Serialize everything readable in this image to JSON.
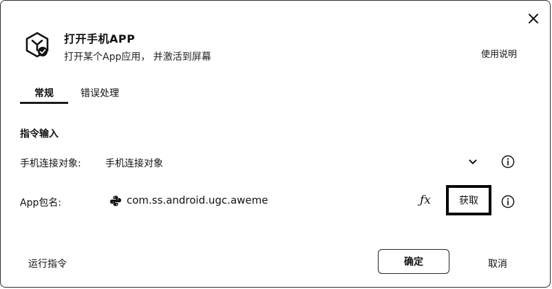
{
  "header": {
    "title": "打开手机APP",
    "subtitle": "打开某个App应用，  并激活到屏幕",
    "help_link": "使用说明"
  },
  "tabs": [
    {
      "label": "常规",
      "active": true
    },
    {
      "label": "错误处理",
      "active": false
    }
  ],
  "section": {
    "label": "指令输入"
  },
  "fields": {
    "device": {
      "label": "手机连接对象:",
      "value": "手机连接对象"
    },
    "package": {
      "label": "App包名:",
      "value": "com.ss.android.ugc.aweme",
      "fx_label": "ƒx",
      "fetch_button": "获取"
    }
  },
  "footer": {
    "run_command": "运行指令",
    "confirm": "确定",
    "cancel": "取消"
  }
}
